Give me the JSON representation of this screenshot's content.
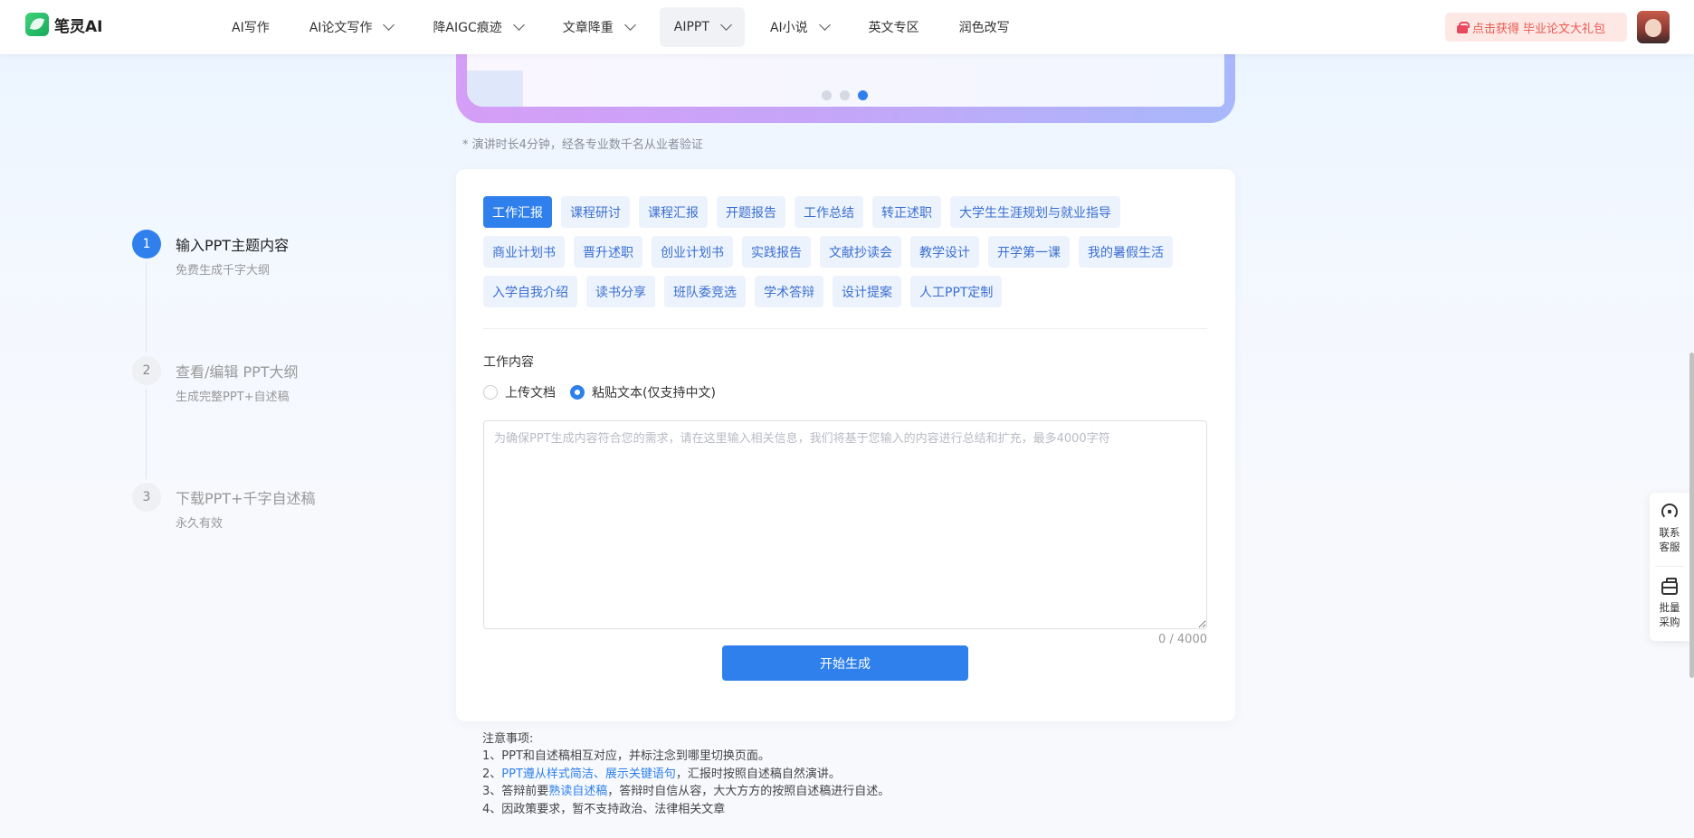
{
  "header": {
    "logo_text": "笔灵AI",
    "nav": [
      {
        "label": "AI写作",
        "dropdown": false,
        "active": false
      },
      {
        "label": "AI论文写作",
        "dropdown": true,
        "active": false
      },
      {
        "label": "降AIGC痕迹",
        "dropdown": true,
        "active": false
      },
      {
        "label": "文章降重",
        "dropdown": true,
        "active": false
      },
      {
        "label": "AIPPT",
        "dropdown": true,
        "active": true
      },
      {
        "label": "AI小说",
        "dropdown": true,
        "active": false
      },
      {
        "label": "英文专区",
        "dropdown": false,
        "active": false
      },
      {
        "label": "润色改写",
        "dropdown": false,
        "active": false
      }
    ],
    "promo": {
      "part1": "点击获得",
      "part2": "毕业论文大礼包"
    }
  },
  "banner": {
    "active_dot": 3,
    "dots": 3
  },
  "tip": "* 演讲时长4分钟，经各专业数千名从业者验证",
  "steps": [
    {
      "num": "1",
      "title": "输入PPT主题内容",
      "sub": "免费生成千字大纲",
      "active": true
    },
    {
      "num": "2",
      "title": "查看/编辑 PPT大纲",
      "sub": "生成完整PPT+自述稿",
      "active": false
    },
    {
      "num": "3",
      "title": "下载PPT+千字自述稿",
      "sub": "永久有效",
      "active": false
    }
  ],
  "tags": [
    "工作汇报",
    "课程研讨",
    "课程汇报",
    "开题报告",
    "工作总结",
    "转正述职",
    "大学生生涯规划与就业指导",
    "商业计划书",
    "晋升述职",
    "创业计划书",
    "实践报告",
    "文献抄读会",
    "教学设计",
    "开学第一课",
    "我的暑假生活",
    "入学自我介绍",
    "读书分享",
    "班队委竞选",
    "学术答辩",
    "设计提案",
    "人工PPT定制"
  ],
  "active_tag": "工作汇报",
  "form": {
    "label": "工作内容",
    "radio_upload": "上传文档",
    "radio_paste": "粘贴文本(仅支持中文)",
    "selected": "paste",
    "placeholder": "为确保PPT生成内容符合您的需求，请在这里输入相关信息，我们将基于您输入的内容进行总结和扩充，最多4000字符",
    "value": "",
    "counter": "0 / 4000",
    "submit": "开始生成"
  },
  "notes": {
    "title": "注意事项:",
    "l1": "1、PPT和自述稿相互对应，并标注念到哪里切换页面。",
    "l2_pre": "2、",
    "l2_hl": "PPT遵从样式简洁、展示关键语句",
    "l2_post": "，汇报时按照自述稿自然演讲。",
    "l3_pre": "3、答辩前要",
    "l3_hl": "熟读自述稿",
    "l3_post": "，答辩时自信从容，大大方方的按照自述稿进行自述。",
    "l4": "4、因政策要求，暂不支持政治、法律相关文章"
  },
  "float": {
    "service": "联系客服",
    "bulk": "批量采购"
  },
  "colors": {
    "accent": "#2f80ed",
    "tag_bg": "#edf3fd",
    "promo_bg": "#fde8e6"
  }
}
